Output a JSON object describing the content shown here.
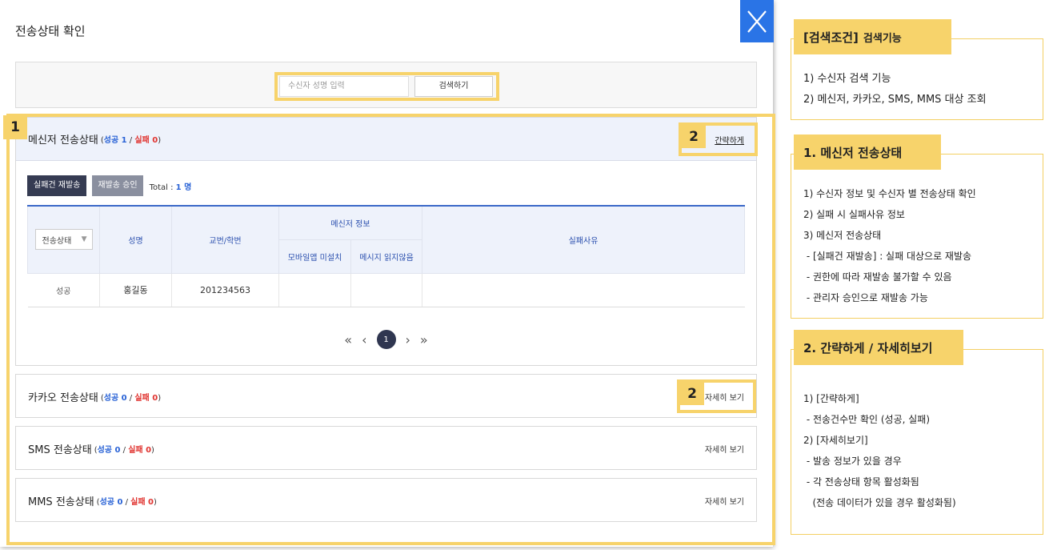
{
  "modal": {
    "title": "전송상태 확인",
    "close_icon": "close-icon"
  },
  "search": {
    "placeholder": "수신자 성명 입력",
    "button": "검색하기"
  },
  "messenger": {
    "title": "메신저 전송상태",
    "open": "(",
    "success_label": "성공 1",
    "sep": " / ",
    "fail_label": "실패 0",
    "close": ")",
    "toggle": "간략하게",
    "resend_button": "실패건 재발송",
    "approve_button": "재발송 승인",
    "total_label": "Total : ",
    "total_value": "1 명",
    "table": {
      "status_filter": "전송상태",
      "col_name": "성명",
      "col_id": "교번/학번",
      "col_group": "메신저 정보",
      "col_app": "모바일앱 미설치",
      "col_unread": "메시지 읽지않음",
      "col_reason": "실패사유",
      "rows": [
        {
          "status": "성공",
          "name": "홍길동",
          "id": "201234563",
          "app": "",
          "unread": "",
          "reason": ""
        }
      ]
    },
    "pager": {
      "first": "«",
      "prev": "‹",
      "current": "1",
      "next": "›",
      "last": "»"
    }
  },
  "kakao": {
    "title": "카카오 전송상태",
    "open": "(",
    "success_label": "성공 0",
    "sep": " / ",
    "fail_label": "실패 0",
    "close": ")",
    "toggle": "자세히 보기"
  },
  "sms": {
    "title": "SMS 전송상태",
    "open": "(",
    "success_label": "성공 0",
    "sep": " / ",
    "fail_label": "실패 0",
    "close": ")",
    "toggle": "자세히 보기"
  },
  "mms": {
    "title": "MMS 전송상태",
    "open": "(",
    "success_label": "성공 0",
    "sep": " / ",
    "fail_label": "실패 0",
    "close": ")",
    "toggle": "자세히 보기"
  },
  "badges": {
    "one": "1",
    "two_a": "2",
    "two_b": "2"
  },
  "panels": [
    {
      "title": "[검색조건]",
      "subtitle": "검색기능",
      "lines": [
        "1) 수신자 검색 기능",
        "2) 메신저, 카카오, SMS, MMS 대상 조회"
      ]
    },
    {
      "title": "1. 메신저 전송상태",
      "subtitle": "",
      "lines": [
        "1) 수신자 정보 및 수신자 별 전송상태 확인",
        "2) 실패 시 실패사유 정보",
        "3) 메신저 전송상태",
        " - [실패건 재발송] : 실패 대상으로 재발송",
        " - 권한에 따라 재발송 불가할 수 있음",
        " - 관리자 승인으로 재발송 가능"
      ]
    },
    {
      "title": "2. 간략하게 / 자세히보기",
      "subtitle": "",
      "lines": [
        "1) [간략하게]",
        " - 전송건수만 확인 (성공, 실패)",
        "2) [자세히보기]",
        " - 발송 정보가 있을 경우",
        " - 각 전송상태 항목 활성화됨",
        "   (전송 데이터가 있을 경우 활성화됨)"
      ]
    }
  ],
  "colors": {
    "accent": "#2a74e6",
    "highlight": "#f7d36b",
    "success": "#2a63d6",
    "fail": "#e0332f"
  }
}
